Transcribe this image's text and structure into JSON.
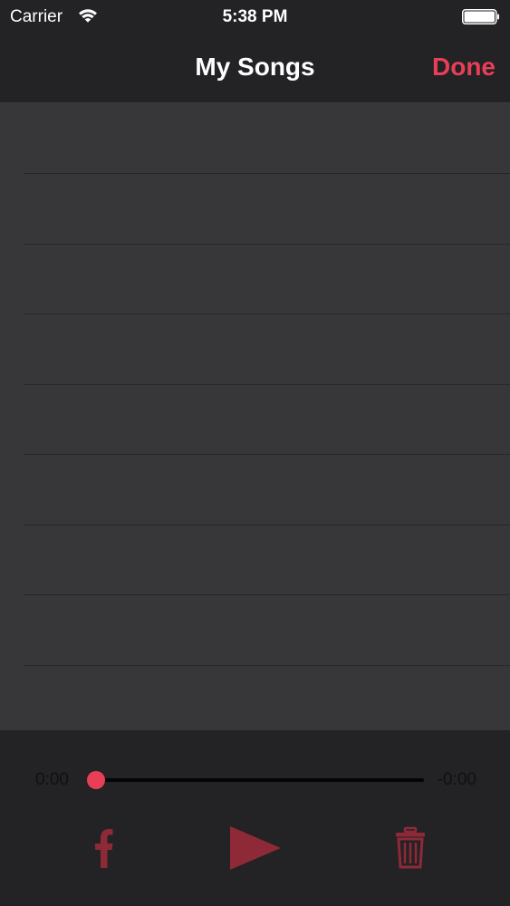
{
  "status_bar": {
    "carrier": "Carrier",
    "time": "5:38 PM",
    "wifi_icon": "wifi-icon",
    "battery_icon": "battery-icon",
    "battery_level": 1.0
  },
  "nav": {
    "title": "My Songs",
    "done_label": "Done"
  },
  "song_list": {
    "rows": [
      "",
      "",
      "",
      "",
      "",
      "",
      "",
      "",
      ""
    ]
  },
  "player": {
    "elapsed": "0:00",
    "remaining": "-0:00",
    "progress": 0,
    "facebook_icon": "facebook-icon",
    "play_icon": "play-icon",
    "trash_icon": "trash-icon"
  },
  "colors": {
    "accent": "#e83f57",
    "icon_dim": "#8e2a38",
    "bar_background": "#232224",
    "list_background": "#373638",
    "separator": "#272628"
  }
}
